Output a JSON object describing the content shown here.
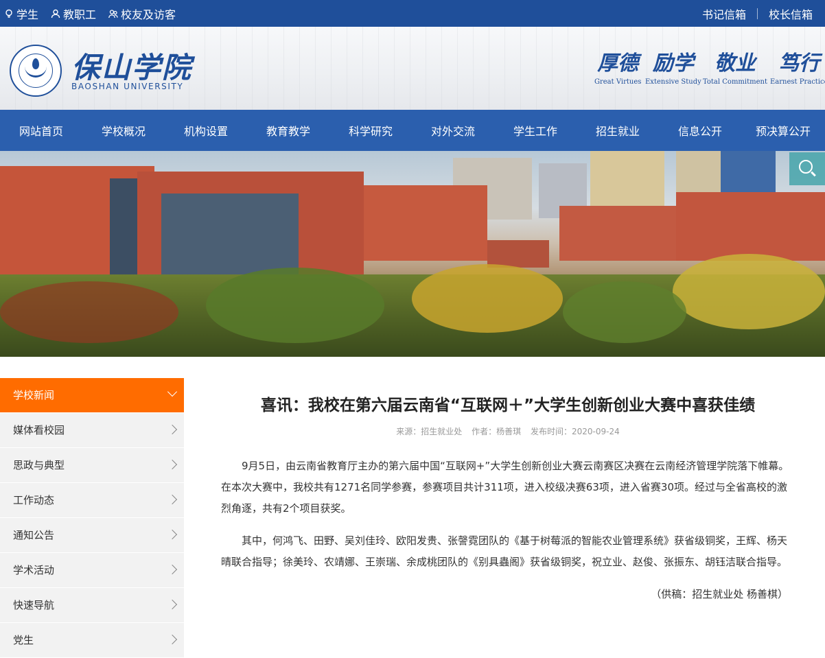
{
  "topbar": {
    "left_links": [
      {
        "label": "学生",
        "icon": "lightbulb-icon"
      },
      {
        "label": "教职工",
        "icon": "person-icon"
      },
      {
        "label": "校友及访客",
        "icon": "people-icon"
      }
    ],
    "right_links": [
      "书记信箱",
      "校长信箱"
    ]
  },
  "header": {
    "brand_cn": "保山学院",
    "brand_en": "BAOSHAN UNIVERSITY",
    "mottos": [
      {
        "cn": "厚德",
        "en": "Great Virtues"
      },
      {
        "cn": "励学",
        "en": "Extensive Study"
      },
      {
        "cn": "敬业",
        "en": "Total Commitment"
      },
      {
        "cn": "笃行",
        "en": "Earnest Practice"
      }
    ]
  },
  "nav": [
    "网站首页",
    "学校概况",
    "机构设置",
    "教育教学",
    "科学研究",
    "对外交流",
    "学生工作",
    "招生就业",
    "信息公开",
    "预决算公开"
  ],
  "sidebar": [
    {
      "label": "学校新闻",
      "active": true
    },
    {
      "label": "媒体看校园",
      "active": false
    },
    {
      "label": "思政与典型",
      "active": false
    },
    {
      "label": "工作动态",
      "active": false
    },
    {
      "label": "通知公告",
      "active": false
    },
    {
      "label": "学术活动",
      "active": false
    },
    {
      "label": "快速导航",
      "active": false
    },
    {
      "label": "党生",
      "active": false
    }
  ],
  "article": {
    "title": "喜讯：我校在第六届云南省“互联网＋”大学生创新创业大赛中喜获佳绩",
    "source": "来源：招生就业处",
    "author": "作者：杨善琪",
    "date": "发布时间：2020-09-24",
    "paragraphs": [
      "9月5日，由云南省教育厅主办的第六届中国“互联网+”大学生创新创业大赛云南赛区决赛在云南经济管理学院落下帷幕。在本次大赛中，我校共有1271名同学参赛，参赛项目共计311项，进入校级决赛63项，进入省赛30项。经过与全省高校的激烈角逐，共有2个项目获奖。",
      "其中，何鸿飞、田野、吴刘佳玲、欧阳发贵、张謦霓团队的《基于树莓派的智能农业管理系统》获省级铜奖，王辉、杨天晴联合指导；徐美玲、农靖娜、王崇瑞、余成桃团队的《别具蟲阁》获省级铜奖，祝立业、赵俊、张振东、胡钰洁联合指导。"
    ],
    "signature": "（供稿：招生就业处 杨善棋）"
  },
  "colors": {
    "topbar": "#1f4f9a",
    "nav": "#2b5fae",
    "active": "#ff6c00"
  }
}
